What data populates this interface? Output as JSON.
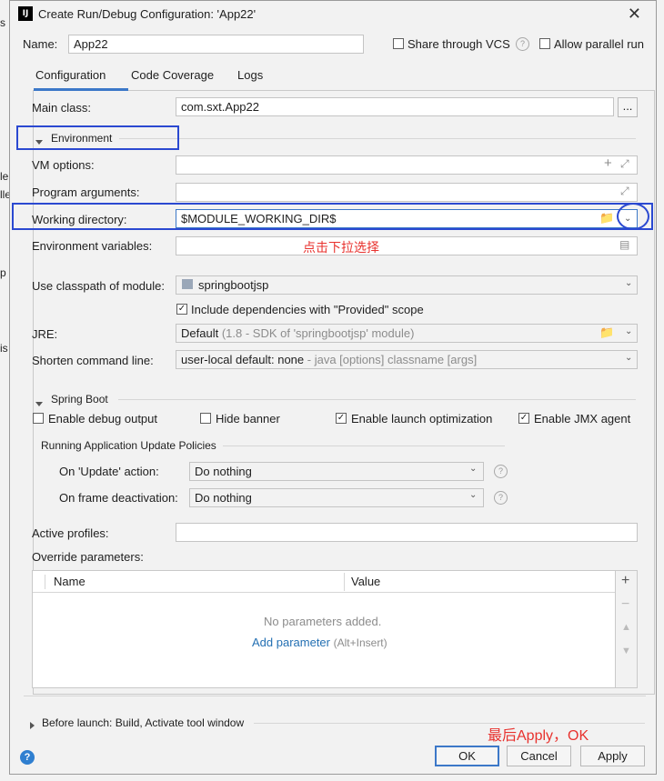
{
  "window": {
    "title": "Create Run/Debug Configuration: 'App22'",
    "app_icon": "IJ"
  },
  "name_row": {
    "label": "Name:",
    "value": "App22",
    "share_vcs": "Share through VCS",
    "allow_parallel": "Allow parallel run",
    "help": "?"
  },
  "tabs": [
    "Configuration",
    "Code Coverage",
    "Logs"
  ],
  "main_class": {
    "label": "Main class:",
    "value": "com.sxt.App22",
    "browse": "..."
  },
  "environment": {
    "header": "Environment"
  },
  "vm_options": {
    "label": "VM options:"
  },
  "program_arguments": {
    "label": "Program arguments:"
  },
  "working_directory": {
    "label": "Working directory:",
    "value": "$MODULE_WORKING_DIR$"
  },
  "environment_variables": {
    "label": "Environment variables:"
  },
  "annotation_dropdown": "点击下拉选择",
  "classpath": {
    "label": "Use classpath of module:",
    "value": "springbootjsp"
  },
  "include_dependencies": {
    "label": "Include dependencies with \"Provided\" scope",
    "checked": true
  },
  "jre": {
    "label": "JRE:",
    "value": "Default",
    "hint": "(1.8 - SDK of 'springbootjsp' module)"
  },
  "shorten_cmd": {
    "label": "Shorten command line:",
    "value": "user-local default: none",
    "hint": "- java [options] classname [args]"
  },
  "spring_boot": {
    "header": "Spring Boot",
    "debug_output": "Enable debug output",
    "hide_banner": "Hide banner",
    "launch_opt": "Enable launch optimization",
    "jmx_agent": "Enable JMX agent"
  },
  "update_policies": {
    "header": "Running Application Update Policies",
    "on_update_label": "On 'Update' action:",
    "on_update_value": "Do nothing",
    "on_frame_label": "On frame deactivation:",
    "on_frame_value": "Do nothing"
  },
  "active_profiles": {
    "label": "Active profiles:"
  },
  "override": {
    "label": "Override parameters:",
    "col_name": "Name",
    "col_value": "Value",
    "empty": "No parameters added.",
    "add_link": "Add parameter",
    "add_hint": "(Alt+Insert)"
  },
  "before_launch": "Before launch: Build, Activate tool window",
  "annotation_apply": "最后Apply，OK",
  "buttons": {
    "ok": "OK",
    "cancel": "Cancel",
    "apply": "Apply"
  },
  "left_edge_fragments": [
    "s",
    "le",
    "lle",
    "p",
    "is"
  ]
}
